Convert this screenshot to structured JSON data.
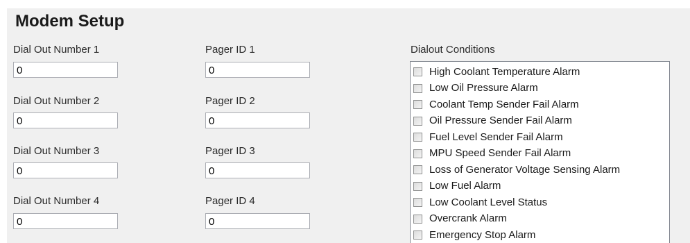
{
  "page": {
    "title": "Modem Setup"
  },
  "dial_out": [
    {
      "label": "Dial Out Number 1",
      "value": "0"
    },
    {
      "label": "Dial Out Number 2",
      "value": "0"
    },
    {
      "label": "Dial Out Number 3",
      "value": "0"
    },
    {
      "label": "Dial Out Number 4",
      "value": "0"
    }
  ],
  "pager": [
    {
      "label": "Pager ID 1",
      "value": "0"
    },
    {
      "label": "Pager ID 2",
      "value": "0"
    },
    {
      "label": "Pager ID 3",
      "value": "0"
    },
    {
      "label": "Pager ID 4",
      "value": "0"
    }
  ],
  "dialout_conditions": {
    "label": "Dialout Conditions",
    "items": [
      {
        "label": "High Coolant Temperature Alarm",
        "checked": false
      },
      {
        "label": "Low Oil Pressure Alarm",
        "checked": false
      },
      {
        "label": "Coolant Temp Sender Fail Alarm",
        "checked": false
      },
      {
        "label": "Oil Pressure Sender Fail Alarm",
        "checked": false
      },
      {
        "label": "Fuel Level Sender Fail Alarm",
        "checked": false
      },
      {
        "label": "MPU Speed Sender Fail Alarm",
        "checked": false
      },
      {
        "label": "Loss of Generator Voltage Sensing Alarm",
        "checked": false
      },
      {
        "label": "Low Fuel Alarm",
        "checked": false
      },
      {
        "label": "Low Coolant Level Status",
        "checked": false
      },
      {
        "label": "Overcrank Alarm",
        "checked": false
      },
      {
        "label": "Emergency Stop Alarm",
        "checked": false
      }
    ]
  }
}
